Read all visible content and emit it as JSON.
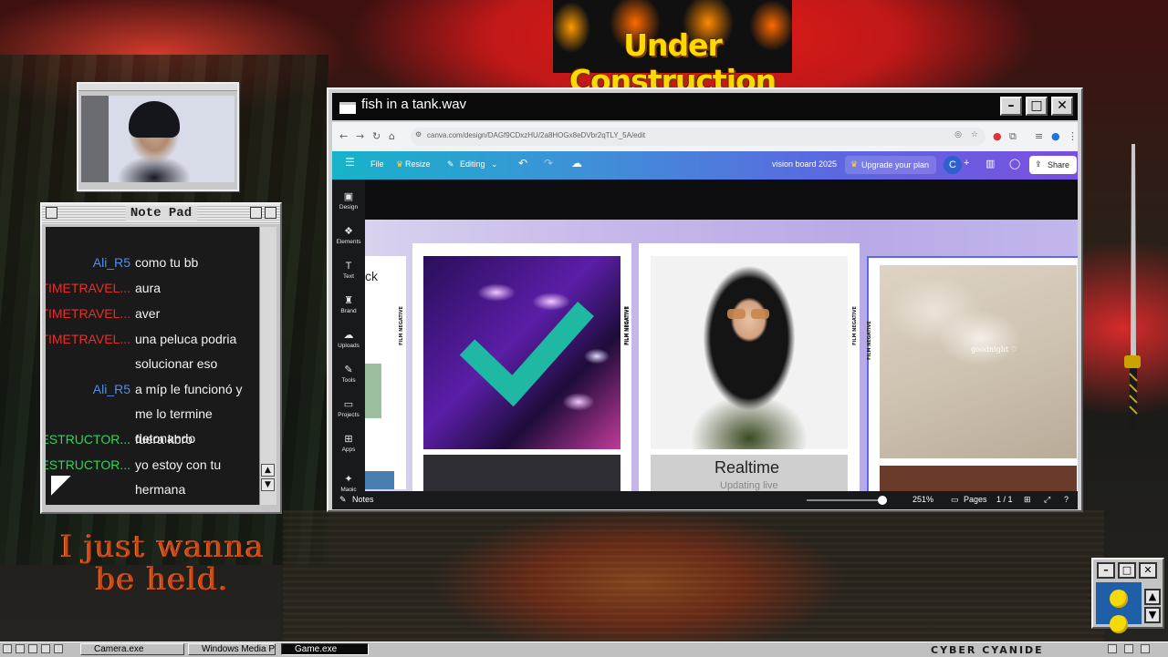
{
  "desktop": {
    "banner": "Under Construction",
    "slogan": "I just wanna be held."
  },
  "notepad": {
    "title": "Note Pad",
    "messages": [
      {
        "user": "Ali_R5",
        "color": "#4d8ef0",
        "text": "como tu bb"
      },
      {
        "user": "TIMETRAVEL...",
        "color": "#e23030",
        "text": "aura"
      },
      {
        "user": "TIMETRAVEL...",
        "color": "#e23030",
        "text": "aver"
      },
      {
        "user": "TIMETRAVEL...",
        "color": "#e23030",
        "text": "una peluca podria solucionar eso"
      },
      {
        "user": "Ali_R5",
        "color": "#4d8ef0",
        "text": "a míp le funcionó y me lo termine detonando"
      },
      {
        "user": "DESTRUCTOR...",
        "color": "#2fd45a",
        "text": "fuera kbro"
      },
      {
        "user": "DESTRUCTOR...",
        "color": "#2fd45a",
        "text": "yo estoy con tu hermana"
      }
    ]
  },
  "browser": {
    "window_title": "fish in a tank.wav",
    "url": "canva.com/design/DAGf9CDxzHU/2a8HOGx8eDVbr2qTLY_5A/edit",
    "canva": {
      "menu": {
        "file": "File",
        "resize": "Resize",
        "editing": "Editing"
      },
      "doc_title": "vision board 2025",
      "upgrade": "Upgrade your plan",
      "avatar": "C",
      "share": "Share",
      "sidebar": [
        "Design",
        "Elements",
        "Text",
        "Brand",
        "Uploads",
        "Tools",
        "Projects",
        "Apps",
        "Magic Media"
      ],
      "board": {
        "film_label": "FILM NEGATIVE",
        "partial_text": "ck",
        "goodnight": "goodnight ♡",
        "realtime": "Realtime",
        "realtime_sub": "Updating live"
      },
      "bottom": {
        "notes": "Notes",
        "zoom": "251%",
        "pages": "Pages",
        "page_count": "1 / 1"
      }
    }
  },
  "taskbar": {
    "tasks": [
      "Camera.exe",
      "Windows Media Pla",
      "Game.exe"
    ],
    "brand": "CYBER CYANIDE"
  },
  "colors": {
    "accent_teal": "#1fb8a3",
    "canva_dark": "#18191b"
  }
}
